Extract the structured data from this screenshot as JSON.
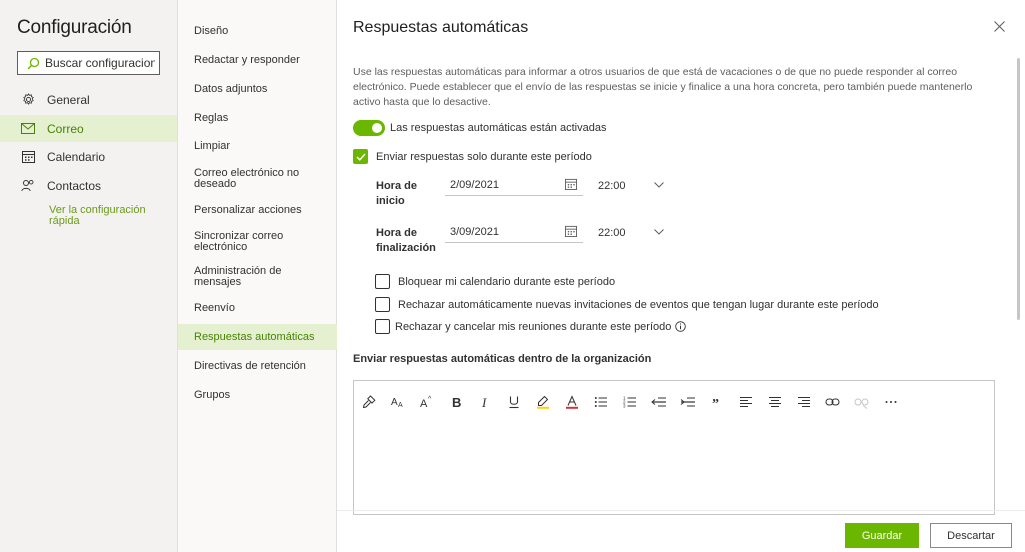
{
  "settings": {
    "title": "Configuración",
    "search_placeholder": "Buscar configuracion...",
    "nav": [
      {
        "label": "General",
        "icon": "gear-icon"
      },
      {
        "label": "Correo",
        "icon": "mail-icon"
      },
      {
        "label": "Calendario",
        "icon": "calendar-icon"
      },
      {
        "label": "Contactos",
        "icon": "people-icon"
      }
    ],
    "quick_link": "Ver la configuración rápida"
  },
  "mail_settings": [
    "Diseño",
    "Redactar y responder",
    "Datos adjuntos",
    "Reglas",
    "Limpiar",
    "Correo electrónico no deseado",
    "Personalizar acciones",
    "Sincronizar correo electrónico",
    "Administración de mensajes",
    "Reenvío",
    "Respuestas automáticas",
    "Directivas de retención",
    "Grupos"
  ],
  "panel": {
    "title": "Respuestas automáticas",
    "description": "Use las respuestas automáticas para informar a otros usuarios de que está de vacaciones o de que no puede responder al correo electrónico. Puede establecer que el envío de las respuestas se inicie y finalice a una hora concreta, pero también puede mantenerlo activo hasta que lo desactive.",
    "toggle_label": "Las respuestas automáticas están activadas",
    "toggle_on": true,
    "period_label": "Enviar respuestas solo durante este período",
    "period_checked": true,
    "start": {
      "label": "Hora de inicio",
      "date": "2/09/2021",
      "time": "22:00"
    },
    "end": {
      "label": "Hora de finalización",
      "date": "3/09/2021",
      "time": "22:00"
    },
    "options": [
      {
        "label": "Bloquear mi calendario durante este período",
        "checked": false
      },
      {
        "label": "Rechazar automáticamente nuevas invitaciones de eventos que tengan lugar durante este período",
        "checked": false
      },
      {
        "label": "Rechazar y cancelar mis reuniones durante este período",
        "checked": false
      }
    ],
    "org_heading": "Enviar respuestas automáticas dentro de la organización",
    "toolbar": [
      "format-painter-icon",
      "font-size-icon",
      "grow-font-icon",
      "bold-icon",
      "italic-icon",
      "underline-icon",
      "highlight-icon",
      "font-color-icon",
      "bullets-icon",
      "numbering-icon",
      "decrease-indent-icon",
      "increase-indent-icon",
      "quote-icon",
      "align-left-icon",
      "align-center-icon",
      "align-right-icon",
      "link-icon",
      "unlink-icon",
      "more-icon"
    ],
    "save_label": "Guardar",
    "discard_label": "Descartar"
  },
  "colors": {
    "accent": "#6bb700",
    "accent_text": "#498205",
    "active_bg": "#e4f0cf"
  }
}
